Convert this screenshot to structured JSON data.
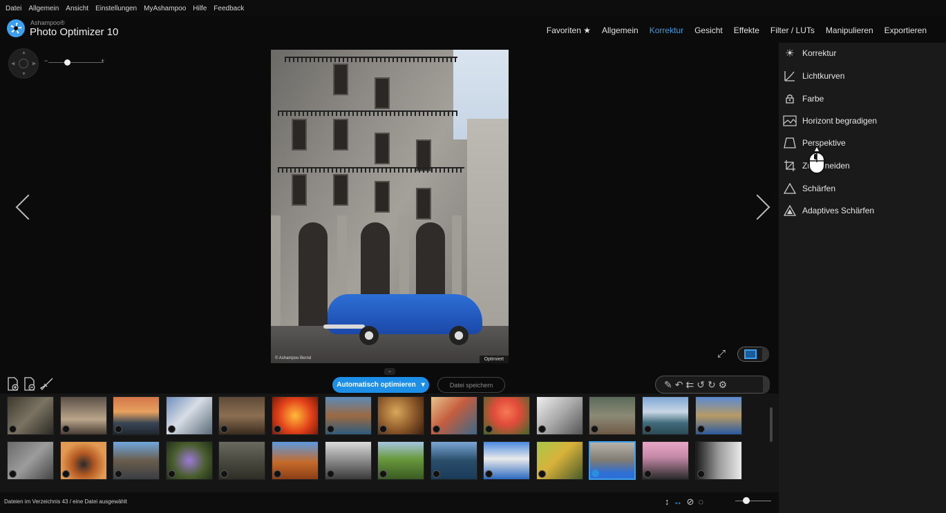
{
  "menu": [
    "Datei",
    "Allgemein",
    "Ansicht",
    "Einstellungen",
    "MyAshampoo",
    "Hilfe",
    "Feedback"
  ],
  "brand": {
    "small": "Ashampoo®",
    "main": "Photo Optimizer 10"
  },
  "top_nav": [
    "Favoriten ★",
    "Allgemein",
    "Korrektur",
    "Gesicht",
    "Effekte",
    "Filter / LUTs",
    "Manipulieren",
    "Exportieren"
  ],
  "top_nav_active": "Korrektur",
  "tools": [
    {
      "label": "Korrektur",
      "icon": "brightness-icon"
    },
    {
      "label": "Lichtkurven",
      "icon": "curve-icon"
    },
    {
      "label": "Farbe",
      "icon": "paint-bucket-icon"
    },
    {
      "label": "Horizont begradigen",
      "icon": "horizon-icon"
    },
    {
      "label": "Perspektive",
      "icon": "perspective-icon"
    },
    {
      "label": "Zuschneiden",
      "icon": "crop-icon"
    },
    {
      "label": "Schärfen",
      "icon": "triangle-icon"
    },
    {
      "label": "Adaptives Schärfen",
      "icon": "adaptive-triangle-icon"
    }
  ],
  "photo": {
    "copyright": "© Ashampoo Bernd",
    "badge": "Optimiert"
  },
  "actions": {
    "auto_optimize": "Automatisch optimieren",
    "save_file": "Datei speichern"
  },
  "status": {
    "text": "Dateien im Verzeichnis 43 / eine Datei ausgewählt"
  },
  "accent_color": "#1e8fe6",
  "zoom_level": 0.45,
  "thumbnail_size": 0.4
}
